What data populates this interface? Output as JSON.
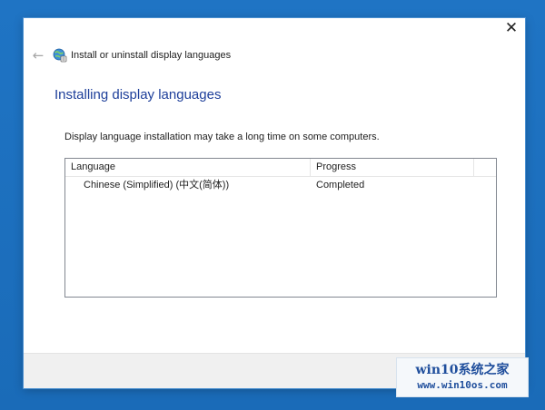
{
  "window": {
    "close_label": "✕"
  },
  "nav": {
    "back_label": "←",
    "title": "Install or uninstall display languages",
    "icon": "globe-settings-icon"
  },
  "main": {
    "heading": "Installing display languages",
    "description": "Display language installation may take a long time on some computers."
  },
  "list": {
    "columns": [
      "Language",
      "Progress"
    ],
    "rows": [
      {
        "language": "Chinese (Simplified) (中文(简体))",
        "progress": "Completed"
      }
    ]
  },
  "watermark": {
    "line1": "win10系统之家",
    "line2": "www.win10os.com"
  },
  "colors": {
    "desktop": "#1a6fbf",
    "heading": "#1e3f9a",
    "watermark_text": "#1f4e9c"
  }
}
